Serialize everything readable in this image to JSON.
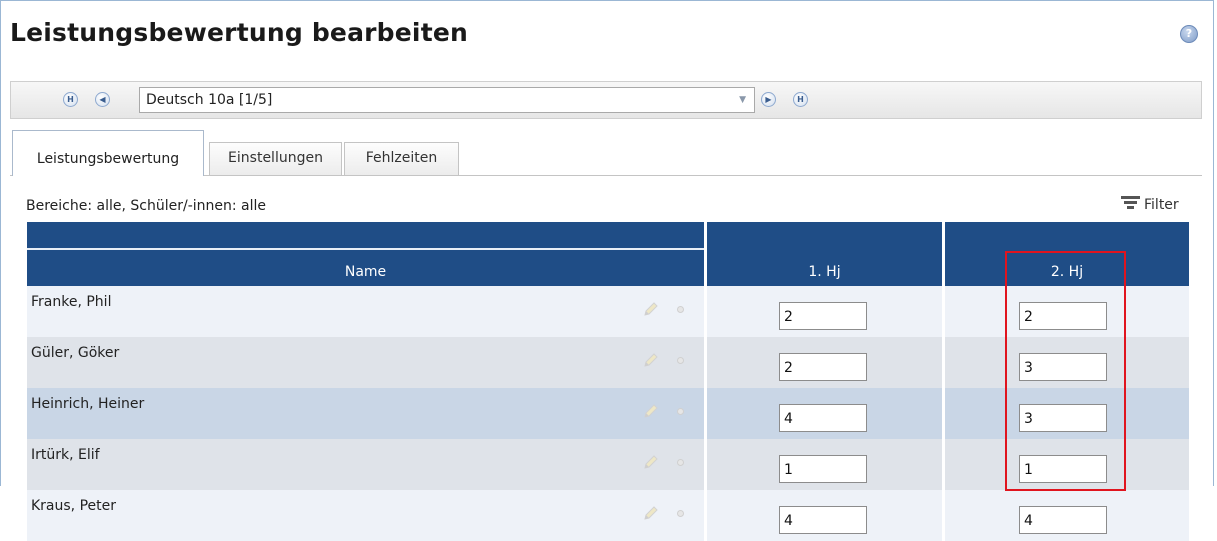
{
  "page": {
    "title": "Leistungsbewertung bearbeiten",
    "help_label": "?"
  },
  "navigator": {
    "first_label": "H",
    "prev_label": "◀",
    "next_label": "▶",
    "last_label": "H",
    "selected": "Deutsch 10a [1/5]",
    "dropdown_arrow": "▼"
  },
  "tabs": [
    {
      "label": "Leistungsbewertung",
      "active": true
    },
    {
      "label": "Einstellungen",
      "active": false
    },
    {
      "label": "Fehlzeiten",
      "active": false
    }
  ],
  "filter": {
    "info": "Bereiche: alle, Schüler/-innen: alle",
    "label": "Filter"
  },
  "table": {
    "headers": {
      "name": "Name",
      "h1": "1. Hj",
      "h2": "2. Hj"
    },
    "rows": [
      {
        "name": "Franke, Phil",
        "h1": "2",
        "h2": "2"
      },
      {
        "name": "Güler, Göker",
        "h1": "2",
        "h2": "3"
      },
      {
        "name": "Heinrich, Heiner",
        "h1": "4",
        "h2": "3"
      },
      {
        "name": "Irtürk, Elif",
        "h1": "1",
        "h2": "1"
      },
      {
        "name": "Kraus, Peter",
        "h1": "4",
        "h2": "4"
      }
    ]
  },
  "colors": {
    "header_bg": "#1f4d86",
    "highlight_border": "#e0141e"
  }
}
